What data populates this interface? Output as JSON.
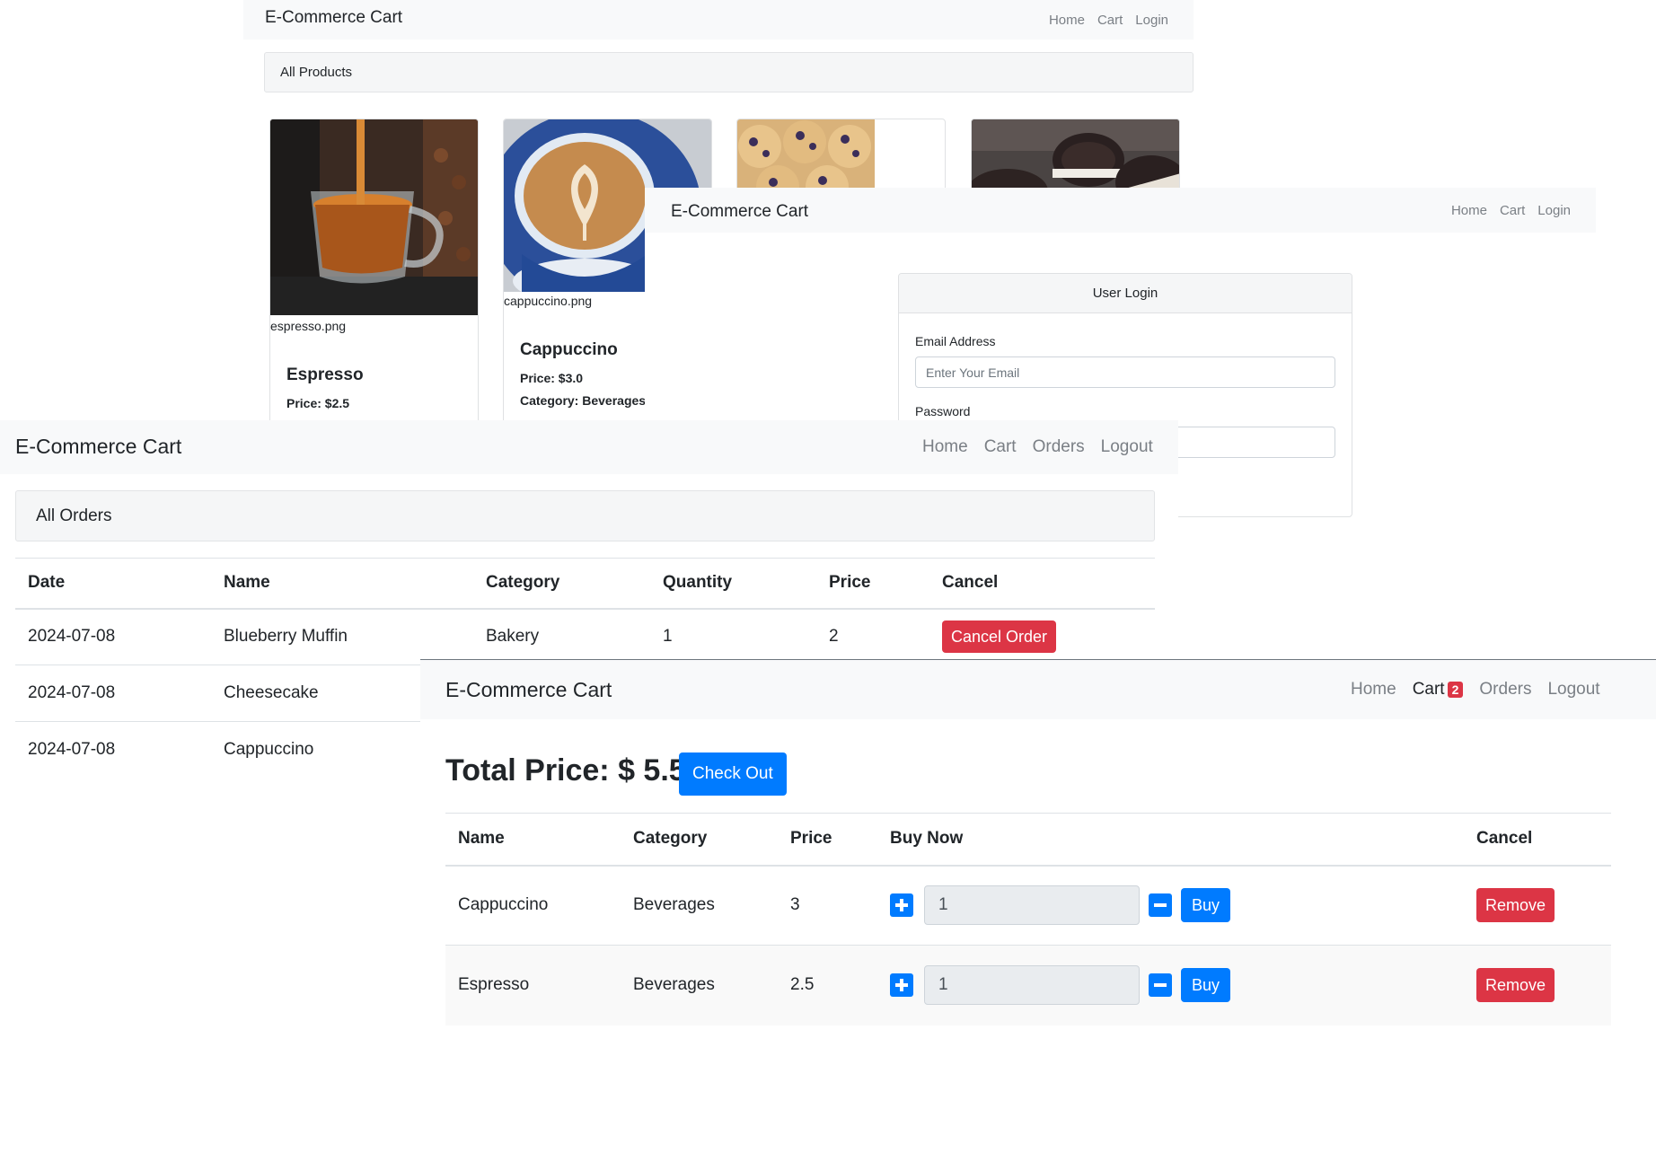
{
  "colors": {
    "primary": "#007bff",
    "danger": "#dc3545",
    "navbar_bg": "#f8f9fa"
  },
  "products_page": {
    "brand": "E-Commerce Cart",
    "nav": [
      "Home",
      "Cart",
      "Login"
    ],
    "header": "All Products",
    "products": [
      {
        "image_caption": "espresso.png",
        "name": "Espresso",
        "price": "Price: $2.5"
      },
      {
        "image_caption": "cappuccino.png",
        "name": "Cappuccino",
        "price": "Price: $3.0",
        "category": "Category: Beverages"
      },
      {
        "image_caption": "",
        "name": ""
      },
      {
        "image_caption": "",
        "name": ""
      }
    ]
  },
  "login_page": {
    "brand": "E-Commerce Cart",
    "nav": [
      "Home",
      "Cart",
      "Login"
    ],
    "card_title": "User Login",
    "email_label": "Email Address",
    "email_placeholder": "Enter Your Email",
    "password_label": "Password"
  },
  "orders_page": {
    "brand": "E-Commerce Cart",
    "nav": [
      "Home",
      "Cart",
      "Orders",
      "Logout"
    ],
    "header": "All Orders",
    "columns": [
      "Date",
      "Name",
      "Category",
      "Quantity",
      "Price",
      "Cancel"
    ],
    "rows": [
      {
        "date": "2024-07-08",
        "name": "Blueberry Muffin",
        "category": "Bakery",
        "quantity": "1",
        "price": "2",
        "action": "Cancel Order"
      },
      {
        "date": "2024-07-08",
        "name": "Cheesecake"
      },
      {
        "date": "2024-07-08",
        "name": "Cappuccino"
      }
    ]
  },
  "cart_page": {
    "brand": "E-Commerce Cart",
    "nav": [
      "Home",
      "Cart",
      "Orders",
      "Logout"
    ],
    "cart_badge": "2",
    "total_label": "Total Price: $ 5.5",
    "checkout_label": "Check Out",
    "columns": [
      "Name",
      "Category",
      "Price",
      "Buy Now",
      "Cancel"
    ],
    "rows": [
      {
        "name": "Cappuccino",
        "category": "Beverages",
        "price": "3",
        "quantity": "1",
        "buy_label": "Buy",
        "remove_label": "Remove"
      },
      {
        "name": "Espresso",
        "category": "Beverages",
        "price": "2.5",
        "quantity": "1",
        "buy_label": "Buy",
        "remove_label": "Remove"
      }
    ]
  }
}
